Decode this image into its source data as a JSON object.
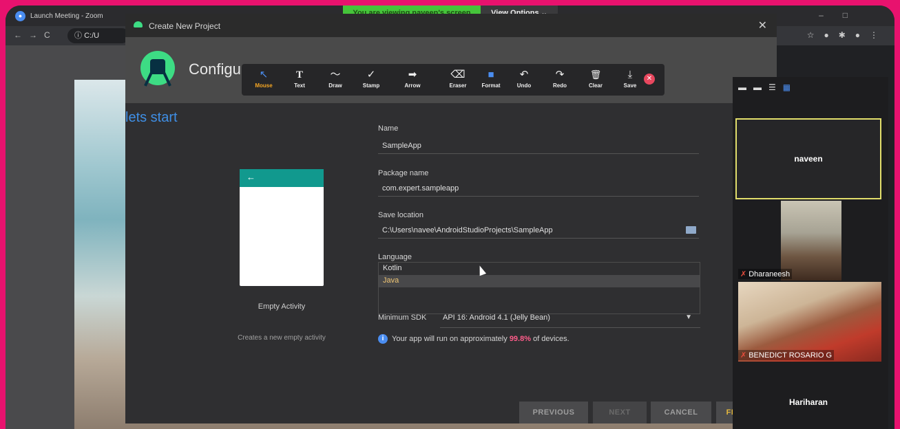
{
  "zoom": {
    "window_title": "Launch Meeting - Zoom",
    "viewing_banner": "You are viewing naveen's screen",
    "view_options": "View Options ⌄"
  },
  "browser": {
    "url_text": "C:/U"
  },
  "slide": {
    "heading": "lets start"
  },
  "dialog": {
    "title": "Create New Project",
    "header": "Configur",
    "template_name": "Empty Activity",
    "template_desc": "Creates a new empty activity",
    "fields": {
      "name_label": "Name",
      "name_value": "SampleApp",
      "package_label": "Package name",
      "package_value": "com.expert.sampleapp",
      "save_label": "Save location",
      "save_value": "C:\\Users\\navee\\AndroidStudioProjects\\SampleApp",
      "language_label": "Language",
      "language_options": [
        "Kotlin",
        "Java"
      ],
      "sdk_label": "Minimum SDK",
      "sdk_value": "API 16: Android 4.1 (Jelly Bean)"
    },
    "info": {
      "prefix": "Your app will run on approximately",
      "percent": "99.8%",
      "suffix": "of devices."
    },
    "buttons": {
      "previous": "PREVIOUS",
      "next": "NEXT",
      "cancel": "CANCEL",
      "finish": "FI"
    }
  },
  "annotation_tools": [
    {
      "label": "Mouse",
      "icon": "↖",
      "icon_name": "mouse-pointer-icon"
    },
    {
      "label": "Text",
      "icon": "T",
      "icon_name": "text-icon"
    },
    {
      "label": "Draw",
      "icon": "〜",
      "icon_name": "draw-icon"
    },
    {
      "label": "Stamp",
      "icon": "✓",
      "icon_name": "stamp-icon"
    },
    {
      "label": "Arrow",
      "icon": "➡",
      "icon_name": "arrow-icon"
    },
    {
      "label": "Eraser",
      "icon": "⌫",
      "icon_name": "eraser-icon"
    },
    {
      "label": "Format",
      "icon": "■",
      "icon_name": "format-icon"
    },
    {
      "label": "Undo",
      "icon": "↶",
      "icon_name": "undo-icon"
    },
    {
      "label": "Redo",
      "icon": "↷",
      "icon_name": "redo-icon"
    },
    {
      "label": "Clear",
      "icon": "🗑",
      "icon_name": "clear-icon"
    },
    {
      "label": "Save",
      "icon": "⤓",
      "icon_name": "save-icon"
    }
  ],
  "participants": [
    {
      "name": "naveen",
      "active": true
    },
    {
      "name": "Dharaneesh",
      "muted": true
    },
    {
      "name": "BENEDICT ROSARIO G",
      "muted": true
    },
    {
      "name": "Hariharan"
    }
  ],
  "colors": {
    "frame": "#e8126e",
    "active_speaker": "#e3df6b",
    "viewing_banner": "#45c43a",
    "link": "#3f8fe6",
    "percent_highlight": "#ff5c8a"
  }
}
